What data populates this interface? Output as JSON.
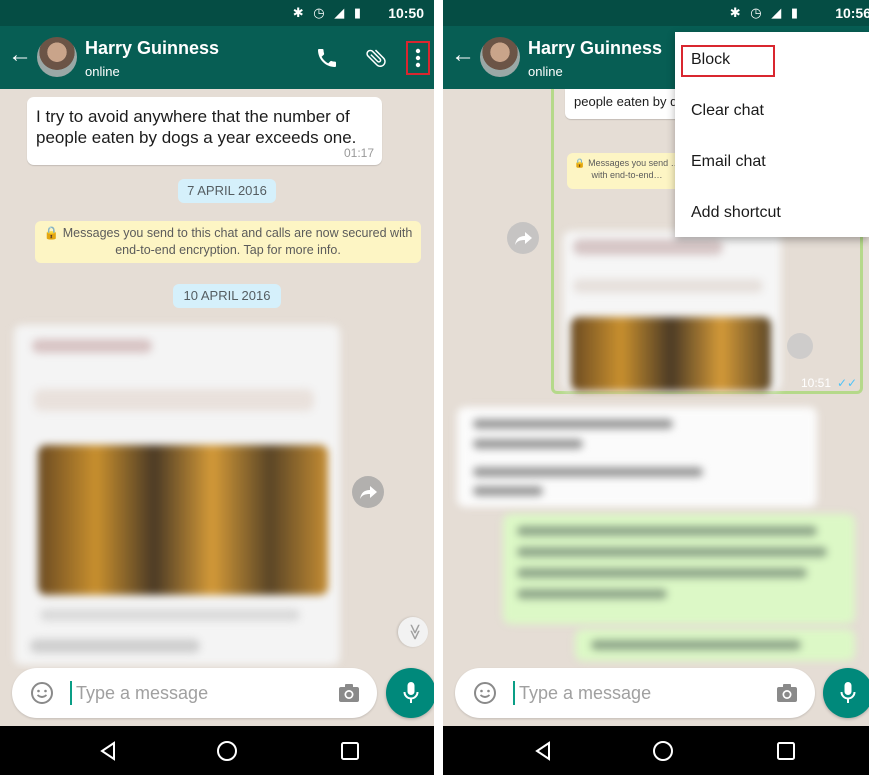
{
  "left": {
    "status_bar": {
      "time": "10:50",
      "icons": "✱ ◷ ◢ ▮"
    },
    "header": {
      "back_icon": "←",
      "contact_name": "Harry Guinness",
      "contact_status": "online"
    },
    "messages": [
      {
        "text": "I try to avoid anywhere that the number of people eaten by dogs a year exceeds one.",
        "time": "01:17"
      }
    ],
    "date_chips": [
      "7 APRIL 2016",
      "10 APRIL 2016"
    ],
    "encryption_notice": "🔒 Messages you send to this chat and calls are now secured with end-to-end encryption. Tap for more info.",
    "input": {
      "placeholder": "Type a message"
    },
    "scroll_down_icon": "≫"
  },
  "right": {
    "status_bar": {
      "time": "10:56",
      "icons": "✱ ◷ ◢ ▮"
    },
    "header": {
      "back_icon": "←",
      "contact_name": "Harry Guinness",
      "contact_status": "online"
    },
    "partial_message": "people eaten by dog",
    "notice_fragment": "🔒 Messages you send … with end-to-end…",
    "image_time": "10:51",
    "image_ticks": "✓✓",
    "menu": {
      "items": [
        "Block",
        "Clear chat",
        "Email chat",
        "Add shortcut"
      ]
    },
    "input": {
      "placeholder": "Type a message"
    }
  },
  "colors": {
    "app_bar": "#075e54",
    "status_bar": "#054d44",
    "chat_bg": "#e5ddd5",
    "accent": "#00897b",
    "highlight": "#d9262f",
    "outgoing_bubble": "#dcf8c6"
  },
  "icons": {
    "status": [
      "bluetooth-icon",
      "alarm-icon",
      "signal-icon",
      "battery-icon"
    ],
    "header": [
      "back-arrow-icon",
      "phone-icon",
      "paperclip-icon",
      "more-vert-icon"
    ],
    "input": [
      "emoji-icon",
      "camera-icon",
      "mic-icon"
    ],
    "nav": [
      "nav-back-icon",
      "nav-home-icon",
      "nav-recents-icon"
    ]
  }
}
